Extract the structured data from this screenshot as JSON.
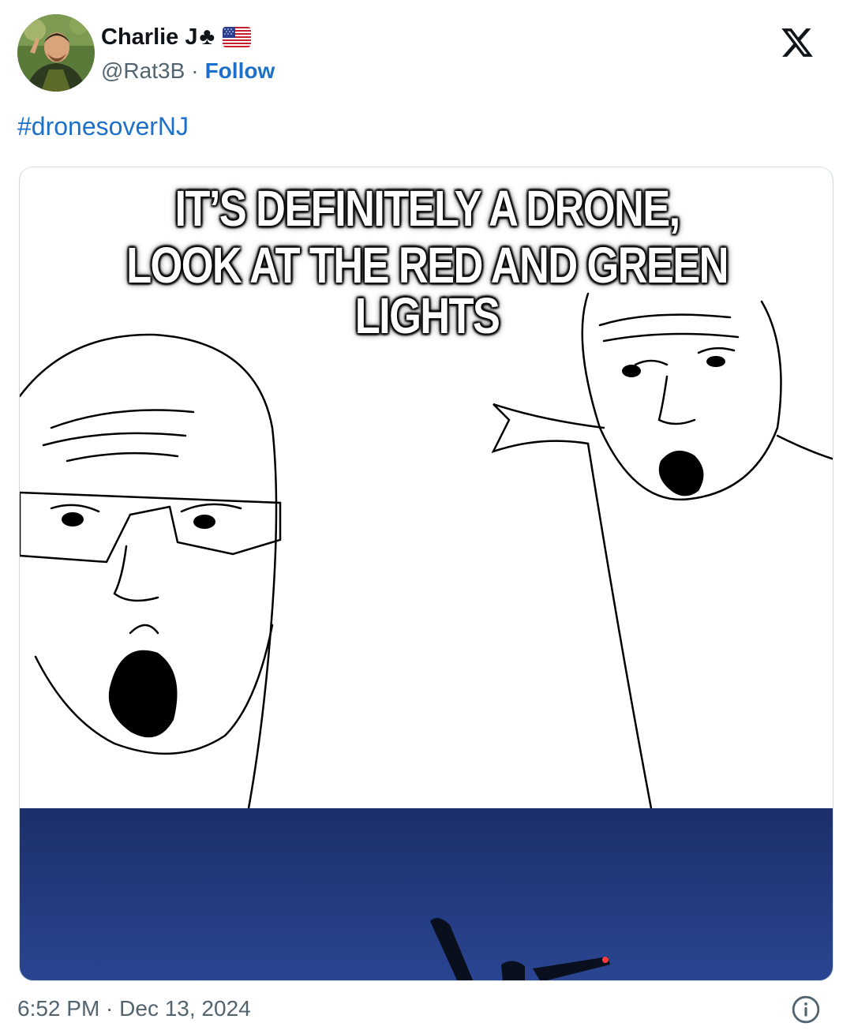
{
  "author": {
    "display_name": "Charlie J",
    "emoji_suit": "♣",
    "emoji_flag": "us-flag-icon",
    "handle": "@Rat3B",
    "separator": "·",
    "follow_label": "Follow"
  },
  "platform_icon": "x-logo-icon",
  "tweet": {
    "hashtag": "#dronesoverNJ"
  },
  "media": {
    "caption_line_1": "IT’S DEFINITELY A DRONE,",
    "caption_line_2": "LOOK AT THE RED AND GREEN LIGHTS"
  },
  "footer": {
    "timestamp": "6:52 PM · Dec 13, 2024",
    "info_icon": "info-icon"
  },
  "colors": {
    "link_blue": "#1d70c9",
    "muted_text": "#536471",
    "night_sky": "#1f3470"
  }
}
